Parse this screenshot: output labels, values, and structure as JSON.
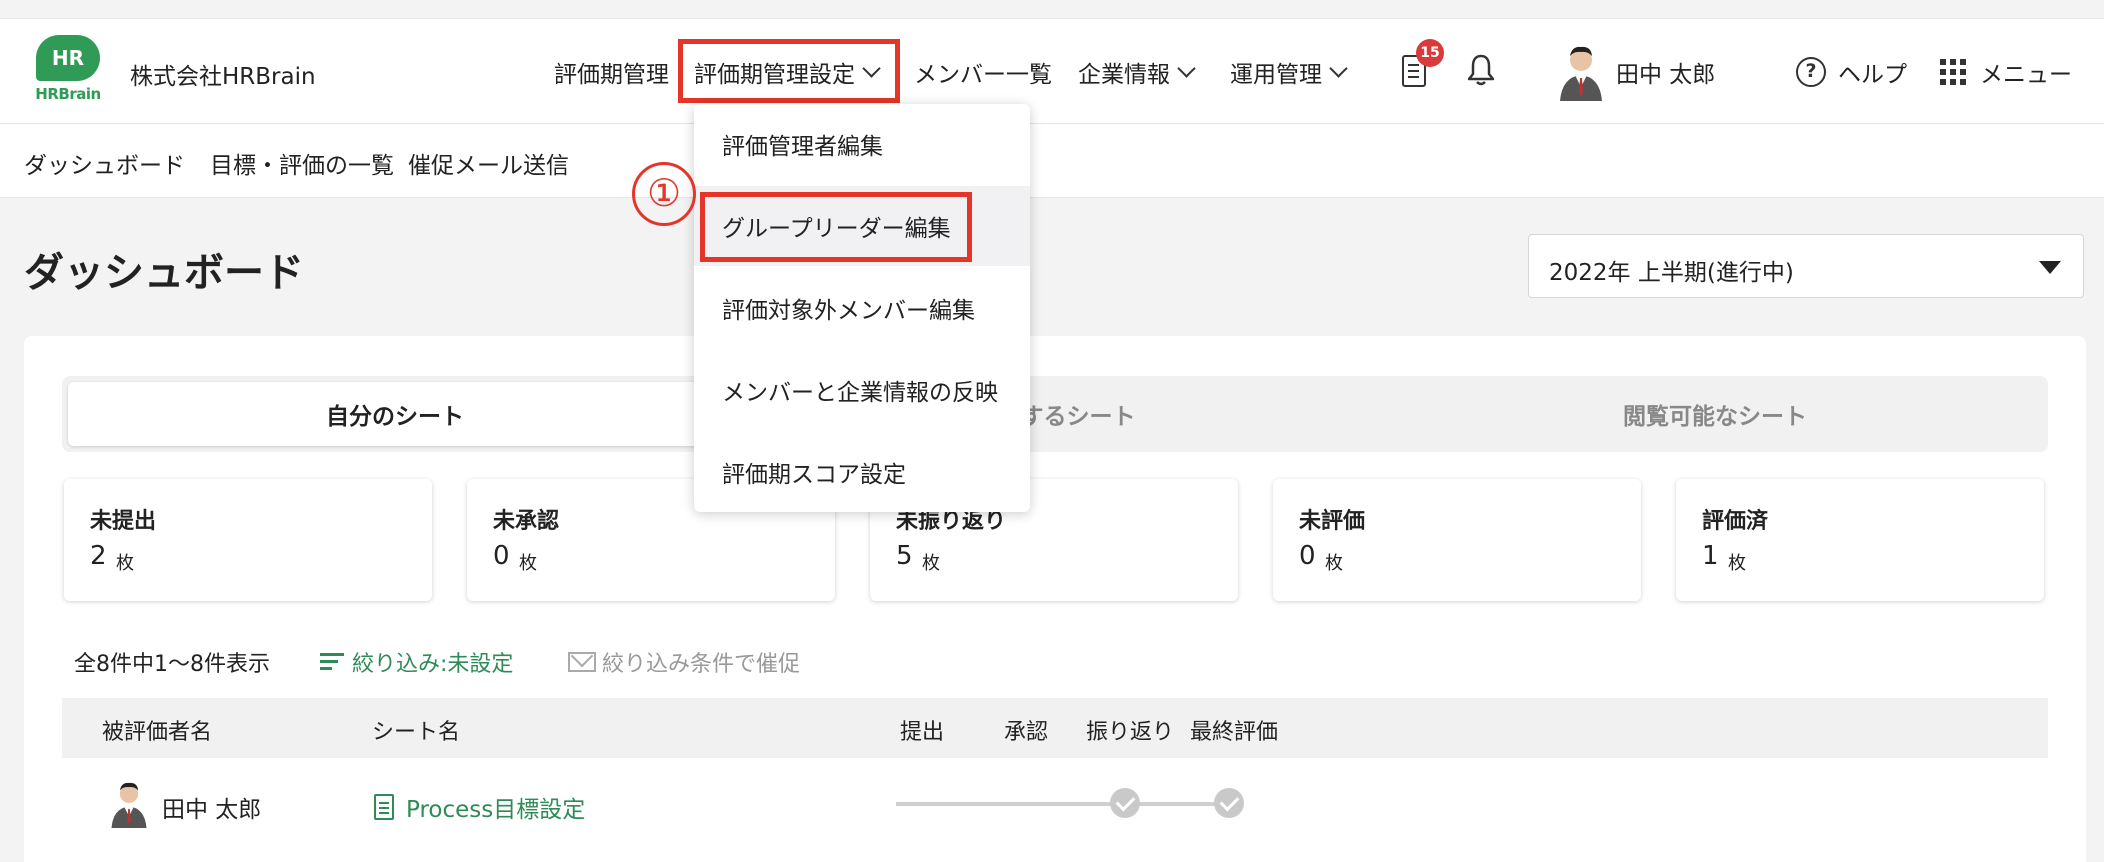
{
  "header": {
    "logo_mark": "HR",
    "logo_word": "HRBrain",
    "company": "株式会社HRBrain",
    "nav": [
      {
        "label": "評価期管理"
      },
      {
        "label": "評価期管理設定"
      },
      {
        "label": "メンバー一覧"
      },
      {
        "label": "企業情報"
      },
      {
        "label": "運用管理"
      }
    ],
    "notification_count": "15",
    "user_name": "田中 太郎",
    "help_label": "ヘルプ",
    "menu_label": "メニュー"
  },
  "subnav": [
    "ダッシュボード",
    "目標・評価の一覧",
    "催促メール送信"
  ],
  "dropdown": {
    "items": [
      "評価管理者編集",
      "グループリーダー編集",
      "評価対象外メンバー編集",
      "メンバーと企業情報の反映",
      "評価期スコア設定"
    ],
    "step_marker": "①"
  },
  "main": {
    "title": "ダッシュボード",
    "period": "2022年 上半期(進行中)",
    "tabs": [
      "自分のシート",
      "承認するシート",
      "閲覧可能なシート"
    ],
    "stats": [
      {
        "label": "未提出",
        "value": "2",
        "unit": "枚"
      },
      {
        "label": "未承認",
        "value": "0",
        "unit": "枚"
      },
      {
        "label": "未振り返り",
        "value": "5",
        "unit": "枚"
      },
      {
        "label": "未評価",
        "value": "0",
        "unit": "枚"
      },
      {
        "label": "評価済",
        "value": "1",
        "unit": "枚"
      }
    ],
    "count_text": "全8件中1〜8件表示",
    "filter_label": "絞り込み:未設定",
    "remind_label": "絞り込み条件で催促",
    "table": {
      "headers": [
        "被評価者名",
        "シート名",
        "提出",
        "承認",
        "振り返り",
        "最終評価"
      ],
      "rows": [
        {
          "name": "田中 太郎",
          "sheet": "Process目標設定"
        }
      ]
    }
  },
  "colors": {
    "accent": "#2e8b57",
    "highlight": "#e53528",
    "badge": "#d93a3a"
  }
}
